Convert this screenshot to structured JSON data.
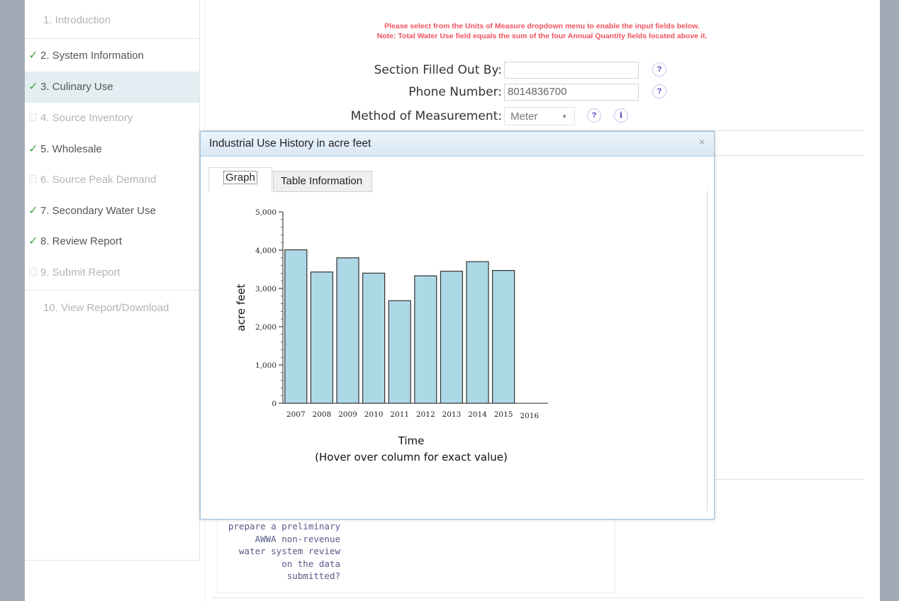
{
  "sidebar": {
    "items": [
      {
        "label": "1. Introduction",
        "state": "plain"
      },
      {
        "label": "2. System Information",
        "state": "checked"
      },
      {
        "label": "3. Culinary Use",
        "state": "checked-active"
      },
      {
        "label": "4. Source Inventory",
        "state": "disabled"
      },
      {
        "label": "5. Wholesale",
        "state": "checked"
      },
      {
        "label": "6. Source Peak Demand",
        "state": "disabled"
      },
      {
        "label": "7. Secondary Water Use",
        "state": "checked"
      },
      {
        "label": "8. Review Report",
        "state": "checked"
      },
      {
        "label": "9. Submit Report",
        "state": "disabled"
      },
      {
        "label": "10. View Report/Download",
        "state": "plain"
      }
    ],
    "check_glyph": "✓"
  },
  "notice": {
    "line1": "Please select from the Units of Measure dropdown menu to enable the input fields below.",
    "line2": "Note: Total Water Use field equals the sum of the four Annual Quantity fields located above it."
  },
  "form": {
    "filled_by_label": "Section Filled Out By:",
    "filled_by_value": "",
    "phone_label": "Phone Number:",
    "phone_value": "8014836700",
    "method_label": "Method of Measurement:",
    "method_value": "Meter",
    "help_glyph": "?",
    "info_glyph": "i",
    "caret_glyph": "▼"
  },
  "question_text": "prepare a preliminary AWWA non-revenue water system review on the data submitted?",
  "question_lines": [
    "prepare a preliminary",
    "AWWA non-revenue",
    "water system review",
    "on the data",
    "submitted?"
  ],
  "dialog": {
    "title": "Industrial Use History in acre feet",
    "close_glyph": "×",
    "tabs": [
      {
        "label": "Graph",
        "active": true
      },
      {
        "label": "Table Information",
        "active": false
      }
    ]
  },
  "chart_data": {
    "type": "bar",
    "categories": [
      "2007",
      "2008",
      "2009",
      "2010",
      "2011",
      "2012",
      "2013",
      "2014",
      "2015",
      "2016"
    ],
    "values": [
      4010,
      3430,
      3800,
      3400,
      2680,
      3330,
      3450,
      3700,
      3470,
      null
    ],
    "xlabel": "Time",
    "xlabel_note": "(Hover over column for exact value)",
    "ylabel": "acre feet",
    "ylim": [
      0,
      5000
    ],
    "yticks": [
      0,
      1000,
      2000,
      3000,
      4000,
      5000
    ],
    "ytick_labels": [
      "0",
      "1,000",
      "2,000",
      "3,000",
      "4,000",
      "5,000"
    ],
    "bar_color": "#add8e6",
    "grid": false
  }
}
